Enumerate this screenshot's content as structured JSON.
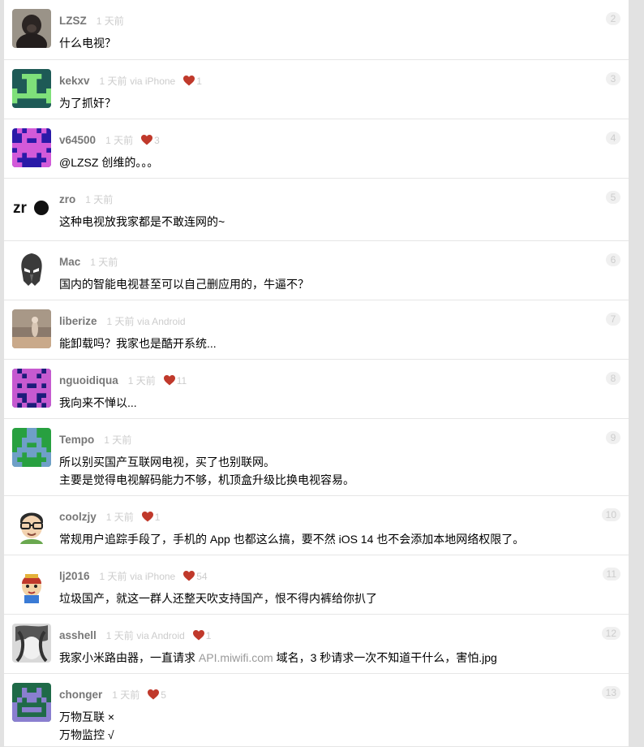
{
  "replies": [
    {
      "user": "LZSZ",
      "time": "1 天前",
      "via": "",
      "hearts": "",
      "no": "2",
      "lines": [
        "什么电视？"
      ]
    },
    {
      "user": "kekxv",
      "time": "1 天前",
      "via": "via iPhone",
      "hearts": "1",
      "no": "3",
      "lines": [
        "为了抓奸？"
      ]
    },
    {
      "user": "v64500",
      "time": "1 天前",
      "via": "",
      "hearts": "3",
      "no": "4",
      "lines": [
        "@LZSZ 创维的。。。"
      ]
    },
    {
      "user": "zro",
      "time": "1 天前",
      "via": "",
      "hearts": "",
      "no": "5",
      "lines": [
        "这种电视放我家都是不敢连网的~"
      ]
    },
    {
      "user": "Mac",
      "time": "1 天前",
      "via": "",
      "hearts": "",
      "no": "6",
      "lines": [
        "国内的智能电视甚至可以自己删应用的，牛逼不？"
      ]
    },
    {
      "user": "liberize",
      "time": "1 天前",
      "via": "via Android",
      "hearts": "",
      "no": "7",
      "lines": [
        "能卸载吗？我家也是酷开系统..."
      ]
    },
    {
      "user": "nguoidiqua",
      "time": "1 天前",
      "via": "",
      "hearts": "11",
      "no": "8",
      "lines": [
        "我向来不惮以..."
      ]
    },
    {
      "user": "Tempo",
      "time": "1 天前",
      "via": "",
      "hearts": "",
      "no": "9",
      "lines": [
        "所以别买国产互联网电视，买了也别联网。",
        "主要是觉得电视解码能力不够，机顶盒升级比换电视容易。"
      ]
    },
    {
      "user": "coolzjy",
      "time": "1 天前",
      "via": "",
      "hearts": "1",
      "no": "10",
      "lines": [
        "常规用户追踪手段了，手机的 App 也都这么搞，要不然 iOS 14 也不会添加本地网络权限了。"
      ]
    },
    {
      "user": "lj2016",
      "time": "1 天前",
      "via": "via iPhone",
      "hearts": "54",
      "no": "11",
      "lines": [
        "垃圾国产，就这一群人还整天吹支持国产，恨不得内裤给你扒了"
      ]
    },
    {
      "user": "asshell",
      "time": "1 天前",
      "via": "via Android",
      "hearts": "1",
      "no": "12",
      "lines": [
        "我家小米路由器，一直请求 API.miwifi.com 域名，3 秒请求一次不知道干什么，害怕.jpg"
      ],
      "domain": "API.miwifi.com"
    },
    {
      "user": "chonger",
      "time": "1 天前",
      "via": "",
      "hearts": "5",
      "no": "13",
      "lines": [
        "万物互联 ×",
        "万物监控 √"
      ]
    }
  ],
  "zro_avatar_text": "zr",
  "colors": {
    "heart": "#c0392b",
    "meta": "#cccccc",
    "username": "#777777"
  }
}
